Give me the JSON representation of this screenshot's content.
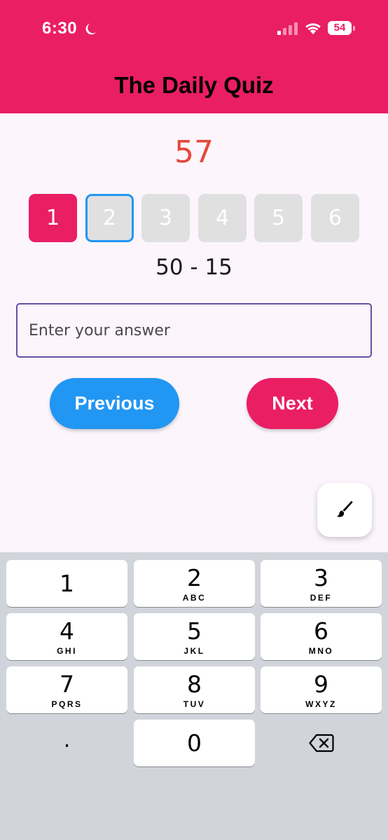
{
  "status_bar": {
    "time": "6:30",
    "battery": "54",
    "icons": [
      "moon-icon",
      "signal-icon",
      "wifi-icon",
      "battery-icon"
    ]
  },
  "app_bar": {
    "title": "The Daily Quiz"
  },
  "quiz": {
    "score": "57",
    "question_tiles": [
      {
        "label": "1",
        "state": "answered"
      },
      {
        "label": "2",
        "state": "current"
      },
      {
        "label": "3",
        "state": "pending"
      },
      {
        "label": "4",
        "state": "pending"
      },
      {
        "label": "5",
        "state": "pending"
      },
      {
        "label": "6",
        "state": "pending"
      }
    ],
    "problem": "50 - 15",
    "answer_input": {
      "value": "",
      "placeholder": "Enter your answer"
    },
    "previous_label": "Previous",
    "next_label": "Next",
    "fab_icon": "brush-icon"
  },
  "keyboard": {
    "keys": [
      {
        "digit": "1",
        "letters": ""
      },
      {
        "digit": "2",
        "letters": "ABC"
      },
      {
        "digit": "3",
        "letters": "DEF"
      },
      {
        "digit": "4",
        "letters": "GHI"
      },
      {
        "digit": "5",
        "letters": "JKL"
      },
      {
        "digit": "6",
        "letters": "MNO"
      },
      {
        "digit": "7",
        "letters": "PQRS"
      },
      {
        "digit": "8",
        "letters": "TUV"
      },
      {
        "digit": "9",
        "letters": "WXYZ"
      },
      {
        "digit": "0",
        "letters": ""
      }
    ],
    "dot_label": ".",
    "delete_icon": "backspace-icon"
  },
  "colors": {
    "primary": "#ea1e63",
    "secondary": "#2196f3",
    "score": "#e5483b",
    "background": "#fcf5fc",
    "keyboard": "#d1d4db"
  }
}
